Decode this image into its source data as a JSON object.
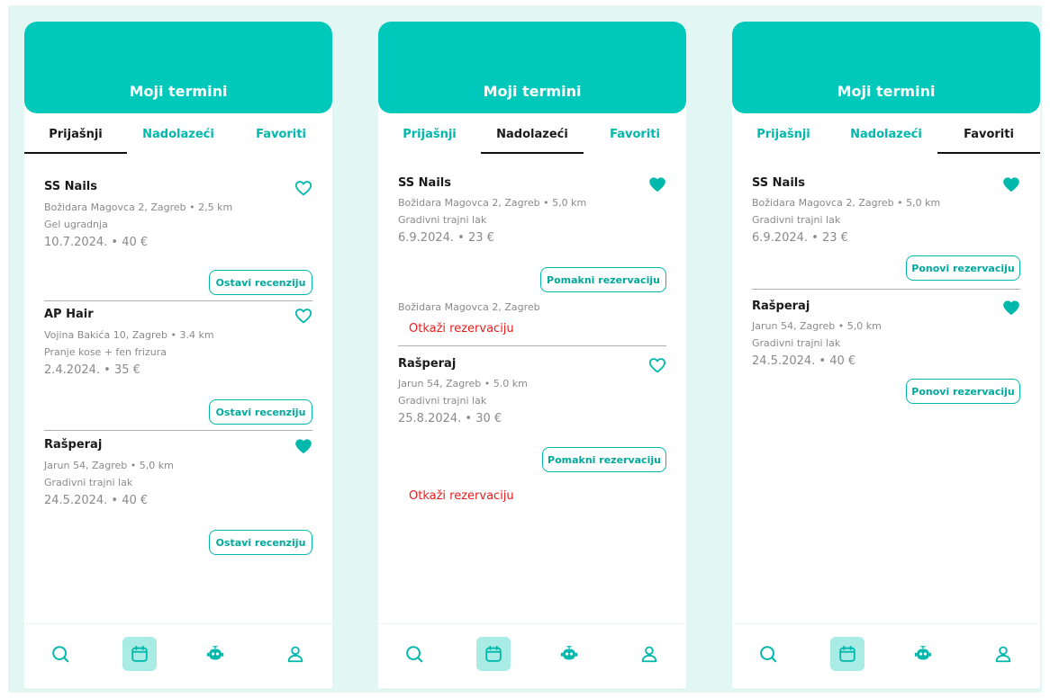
{
  "colors": {
    "accent": "#00c9bc",
    "cancel": "#ee1c1c",
    "text": "#1a1a1a",
    "muted": "#8a8a8a"
  },
  "screens": [
    {
      "title": "Moji termini",
      "tabs": [
        "Prijašnji",
        "Nadolazeći",
        "Favoriti"
      ],
      "active_tab": "Prijašnji",
      "entries": [
        {
          "name": "SS Nails",
          "address": "Božidara Magovca 2, Zagreb  •  2,5 km",
          "service": "Gel ugradnja",
          "date_price": "10.7.2024. • 40 €",
          "favorite": false,
          "button": "Ostavi recenziju"
        },
        {
          "name": "AP Hair",
          "address": "Vojina Bakića 10, Zagreb  •  3.4 km",
          "service": "Pranje kose + fen frizura",
          "date_price": "2.4.2024. • 35 €",
          "favorite": false,
          "button": "Ostavi recenziju"
        },
        {
          "name": "Rašperaj",
          "address": "Jarun 54,  Zagreb  •  5,0 km",
          "service": "Gradivni trajni  lak",
          "date_price": "24.5.2024. • 40 €",
          "favorite": true,
          "button": "Ostavi recenziju"
        }
      ]
    },
    {
      "title": "Moji termini",
      "tabs": [
        "Prijašnji",
        "Nadolazeći",
        "Favoriti"
      ],
      "active_tab": "Nadolazeći",
      "entries": [
        {
          "name": "SS Nails",
          "address": "Božidara Magovca 2,  Zagreb  •  5,0 km",
          "service": "Gradivni trajni lak",
          "date_price": "6.9.2024. • 23 €",
          "favorite": true,
          "button": "Pomakni  rezervaciju",
          "extra_address": "Božidara Magovca 2,  Zagreb",
          "cancel": "Otkaži rezervaciju"
        },
        {
          "name": "Rašperaj",
          "address": "Jarun 54, Zagreb  •  5.0 km",
          "service": "Gradivni trajni lak",
          "date_price": "25.8.2024. • 30 €",
          "favorite": false,
          "button": "Pomakni rezervaciju",
          "cancel": "Otkaži rezervaciju"
        }
      ]
    },
    {
      "title": "Moji termini",
      "tabs": [
        "Prijašnji",
        "Nadolazeći",
        "Favoriti"
      ],
      "active_tab": "Favoriti",
      "entries": [
        {
          "name": "SS Nails",
          "address": "Božidara Magovca 2,  Zagreb  •  5,0 km",
          "service": "Gradivni trajni lak",
          "date_price": "6.9.2024. • 23 €",
          "favorite": true,
          "button": "Ponovi rezervaciju"
        },
        {
          "name": "Rašperaj",
          "address": "Jarun 54,  Zagreb  •  5,0 km",
          "service": "Gradivni trajni  lak",
          "date_price": "24.5.2024. • 40 €",
          "favorite": true,
          "button": "Ponovi rezervaciju"
        }
      ]
    }
  ],
  "bottom_nav": [
    {
      "icon": "search-icon",
      "active": false
    },
    {
      "icon": "calendar-icon",
      "active": true
    },
    {
      "icon": "robot-icon",
      "active": false
    },
    {
      "icon": "user-icon",
      "active": false
    }
  ]
}
